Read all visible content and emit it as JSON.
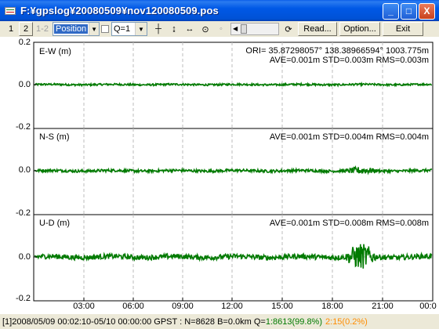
{
  "window": {
    "title": "F:¥gpslog¥20080509¥nov120080509.pos",
    "minimize": "_",
    "maximize": "□",
    "close": "X"
  },
  "toolbar": {
    "btn1": "1",
    "btn2": "2",
    "btn12": "1-2",
    "plot_type": "Position",
    "quality": "Q=1",
    "read_label": "Read...",
    "option_label": "Option...",
    "exit_label": "Exit"
  },
  "plots": [
    {
      "name": "E-W (m)",
      "ori": "ORI= 35.87298057°  138.38966594°  1003.775m",
      "stats": "AVE=0.001m STD=0.003m RMS=0.003m",
      "noise": 0.0028,
      "spike": 0.0
    },
    {
      "name": "N-S (m)",
      "ori": "",
      "stats": "AVE=0.001m STD=0.004m RMS=0.004m",
      "noise": 0.004,
      "spike": 0.006
    },
    {
      "name": "U-D (m)",
      "ori": "",
      "stats": "AVE=0.001m STD=0.008m RMS=0.008m",
      "noise": 0.0075,
      "spike": 0.014
    }
  ],
  "yticks": [
    "0.2",
    "0.0",
    "-0.2",
    "0.0",
    "-0.2",
    "0.0",
    "-0.2"
  ],
  "xticks": [
    "03:00",
    "06:00",
    "09:00",
    "12:00",
    "15:00",
    "18:00",
    "21:00",
    "00:0"
  ],
  "colors": {
    "series": "#007a00",
    "q2": "#ff8c00",
    "grid": "#bdbdbd"
  },
  "status": {
    "prefix": "[1]2008/05/09 00:02:10-05/10 00:00:00 GPST : N=8628 B=0.0km Q=",
    "q1": "1:8613(99.8%)",
    "q2": "2:15(0.2%)"
  }
}
